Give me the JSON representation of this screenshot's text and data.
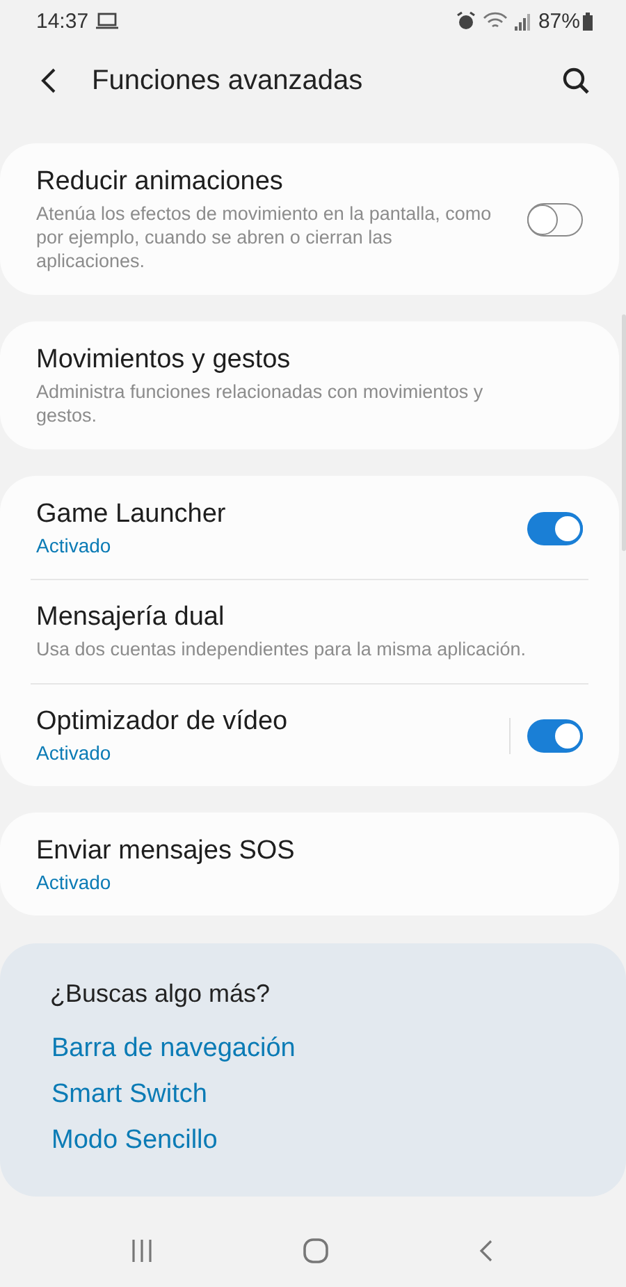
{
  "status_bar": {
    "time": "14:37",
    "battery": "87%"
  },
  "header": {
    "title": "Funciones avanzadas"
  },
  "cards": [
    {
      "items": [
        {
          "kind": "toggle",
          "title": "Reducir animaciones",
          "description": "Atenúa los efectos de movimiento en la pantalla, como por ejemplo, cuando se abren o cierran las aplicaciones.",
          "on": false
        }
      ]
    },
    {
      "items": [
        {
          "kind": "link",
          "title": "Movimientos y gestos",
          "description": "Administra funciones relacionadas con movimientos y gestos."
        }
      ]
    },
    {
      "items": [
        {
          "kind": "toggle",
          "title": "Game Launcher",
          "status": "Activado",
          "on": true
        },
        {
          "kind": "link",
          "title": "Mensajería dual",
          "description": "Usa dos cuentas independientes para la misma aplicación."
        },
        {
          "kind": "split-toggle",
          "title": "Optimizador de vídeo",
          "status": "Activado",
          "on": true
        }
      ]
    },
    {
      "items": [
        {
          "kind": "link",
          "title": "Enviar mensajes SOS",
          "status": "Activado"
        }
      ]
    }
  ],
  "suggestions": {
    "title": "¿Buscas algo más?",
    "links": [
      "Barra de navegación",
      "Smart Switch",
      "Modo Sencillo"
    ]
  }
}
